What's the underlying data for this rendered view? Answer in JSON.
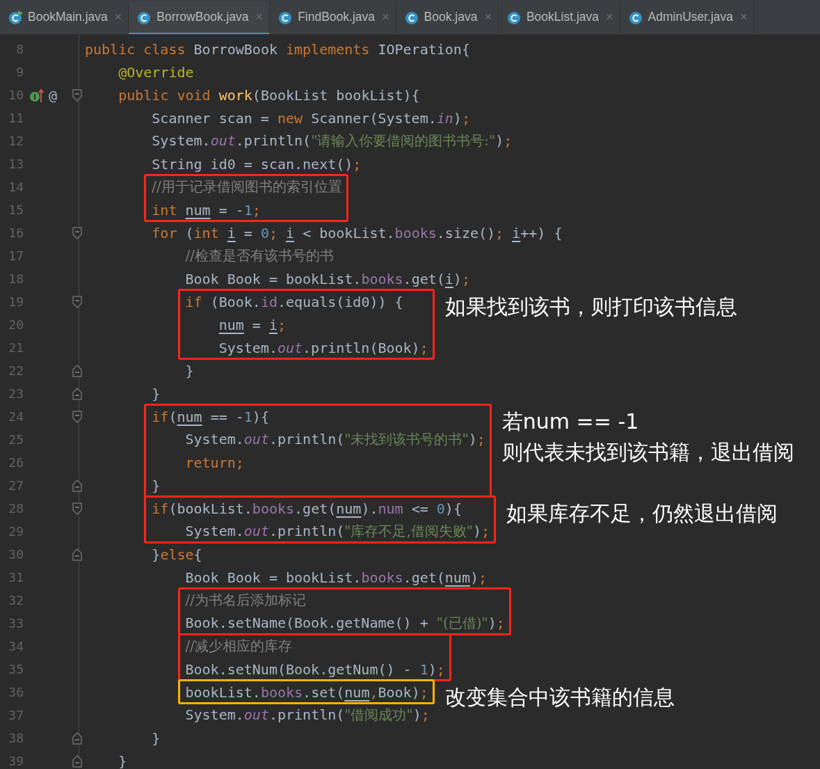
{
  "tabs": [
    {
      "label": "BookMain.java",
      "selected": false,
      "runnable": true,
      "close": "×"
    },
    {
      "label": "BorrowBook.java",
      "selected": true,
      "runnable": false,
      "close": "×"
    },
    {
      "label": "FindBook.java",
      "selected": false,
      "runnable": false,
      "close": "×"
    },
    {
      "label": "Book.java",
      "selected": false,
      "runnable": false,
      "close": "×"
    },
    {
      "label": "BookList.java",
      "selected": false,
      "runnable": false,
      "close": "×"
    },
    {
      "label": "AdminUser.java",
      "selected": false,
      "runnable": false,
      "close": "×"
    }
  ],
  "code": [
    {
      "kind": "line",
      "number": "8",
      "tokens": [
        {
          "kind": "kw",
          "text": "public class "
        },
        {
          "kind": "text",
          "text": "BorrowBook "
        },
        {
          "kind": "kw",
          "text": "implements "
        },
        {
          "kind": "text",
          "text": "IOPeration{"
        }
      ]
    },
    {
      "kind": "line",
      "number": "9",
      "tokens": [
        {
          "kind": "ann",
          "text": "    @Override"
        }
      ]
    },
    {
      "kind": "line",
      "number": "10",
      "fold_start": true,
      "implements_marker": true,
      "gutter_mark": "@",
      "tokens": [
        {
          "kind": "kw",
          "text": "    public void "
        },
        {
          "kind": "fn",
          "text": "work"
        },
        {
          "kind": "text",
          "text": "(BookList bookList){"
        }
      ]
    },
    {
      "kind": "line",
      "number": "11",
      "tokens": [
        {
          "kind": "text",
          "text": "        Scanner scan = "
        },
        {
          "kind": "kw",
          "text": "new "
        },
        {
          "kind": "text",
          "text": "Scanner(System."
        },
        {
          "kind": "static",
          "text": "in"
        },
        {
          "kind": "text",
          "text": ")"
        },
        {
          "kind": "kw",
          "text": ";"
        }
      ]
    },
    {
      "kind": "line",
      "number": "12",
      "tokens": [
        {
          "kind": "text",
          "text": "        System."
        },
        {
          "kind": "static",
          "text": "out"
        },
        {
          "kind": "text",
          "text": ".println("
        },
        {
          "kind": "str",
          "text": "\"请输入你要借阅的图书书号:\""
        },
        {
          "kind": "text",
          "text": ")"
        },
        {
          "kind": "kw",
          "text": ";"
        }
      ]
    },
    {
      "kind": "line",
      "number": "13",
      "tokens": [
        {
          "kind": "text",
          "text": "        String id0 = scan.next()"
        },
        {
          "kind": "kw",
          "text": ";"
        }
      ]
    },
    {
      "kind": "box",
      "color": "#ff2419",
      "lines": [
        {
          "kind": "line",
          "number": "14",
          "tokens": [
            {
              "kind": "comment",
              "text": "        //用于记录借阅图书的索引位置"
            }
          ]
        },
        {
          "kind": "line",
          "number": "15",
          "tokens": [
            {
              "kind": "kw",
              "text": "        int "
            },
            {
              "kind": "var",
              "text": "num"
            },
            {
              "kind": "text",
              "text": " = -"
            },
            {
              "kind": "num",
              "text": "1"
            },
            {
              "kind": "kw",
              "text": ";"
            }
          ]
        }
      ]
    },
    {
      "kind": "line",
      "number": "16",
      "fold_start": true,
      "tokens": [
        {
          "kind": "kw",
          "text": "        for "
        },
        {
          "kind": "text",
          "text": "("
        },
        {
          "kind": "kw",
          "text": "int "
        },
        {
          "kind": "var",
          "text": "i"
        },
        {
          "kind": "text",
          "text": " = "
        },
        {
          "kind": "num",
          "text": "0"
        },
        {
          "kind": "kw",
          "text": "; "
        },
        {
          "kind": "var",
          "text": "i"
        },
        {
          "kind": "text",
          "text": " < bookList."
        },
        {
          "kind": "field",
          "text": "books"
        },
        {
          "kind": "text",
          "text": ".size()"
        },
        {
          "kind": "kw",
          "text": "; "
        },
        {
          "kind": "var",
          "text": "i"
        },
        {
          "kind": "text",
          "text": "++) {"
        }
      ]
    },
    {
      "kind": "line",
      "number": "17",
      "tokens": [
        {
          "kind": "comment",
          "text": "            //检查是否有该书号的书"
        }
      ]
    },
    {
      "kind": "line",
      "number": "18",
      "tokens": [
        {
          "kind": "text",
          "text": "            Book Book = bookList."
        },
        {
          "kind": "field",
          "text": "books"
        },
        {
          "kind": "text",
          "text": ".get("
        },
        {
          "kind": "var",
          "text": "i"
        },
        {
          "kind": "text",
          "text": ")"
        },
        {
          "kind": "kw",
          "text": ";"
        }
      ]
    },
    {
      "kind": "box",
      "color": "#ff2419",
      "note": [
        "如果找到该书，则打印该书信息"
      ],
      "lines": [
        {
          "kind": "line",
          "number": "19",
          "fold_start": true,
          "tokens": [
            {
              "kind": "kw",
              "text": "            if "
            },
            {
              "kind": "text",
              "text": "(Book."
            },
            {
              "kind": "field",
              "text": "id"
            },
            {
              "kind": "text",
              "text": ".equals(id0)) {"
            }
          ]
        },
        {
          "kind": "line",
          "number": "20",
          "tokens": [
            {
              "kind": "var",
              "text": "                num"
            },
            {
              "kind": "text",
              "text": " = "
            },
            {
              "kind": "var",
              "text": "i"
            },
            {
              "kind": "kw",
              "text": ";"
            }
          ]
        },
        {
          "kind": "line",
          "number": "21",
          "tokens": [
            {
              "kind": "text",
              "text": "                System."
            },
            {
              "kind": "static",
              "text": "out"
            },
            {
              "kind": "text",
              "text": ".println(Book)"
            },
            {
              "kind": "kw",
              "text": ";"
            }
          ]
        }
      ]
    },
    {
      "kind": "line",
      "number": "22",
      "fold_end": true,
      "tokens": [
        {
          "kind": "text",
          "text": "            }"
        }
      ]
    },
    {
      "kind": "line",
      "number": "23",
      "fold_end": true,
      "tokens": [
        {
          "kind": "text",
          "text": "        }"
        }
      ]
    },
    {
      "kind": "box",
      "color": "#ff2419",
      "note": [
        "若num == -1",
        "则代表未找到该书籍，退出借阅"
      ],
      "lines": [
        {
          "kind": "line",
          "number": "24",
          "fold_start": true,
          "tokens": [
            {
              "kind": "kw",
              "text": "        if"
            },
            {
              "kind": "text",
              "text": "("
            },
            {
              "kind": "var",
              "text": "num"
            },
            {
              "kind": "text",
              "text": " == -"
            },
            {
              "kind": "num",
              "text": "1"
            },
            {
              "kind": "text",
              "text": "){"
            }
          ]
        },
        {
          "kind": "line",
          "number": "25",
          "tokens": [
            {
              "kind": "text",
              "text": "            System."
            },
            {
              "kind": "static",
              "text": "out"
            },
            {
              "kind": "text",
              "text": ".println("
            },
            {
              "kind": "str",
              "text": "\"未找到该书号的书\""
            },
            {
              "kind": "text",
              "text": ")"
            },
            {
              "kind": "kw",
              "text": ";"
            }
          ]
        },
        {
          "kind": "line",
          "number": "26",
          "tokens": [
            {
              "kind": "kw",
              "text": "            return;"
            }
          ]
        },
        {
          "kind": "line",
          "number": "27",
          "fold_end": true,
          "tokens": [
            {
              "kind": "text",
              "text": "        }"
            }
          ]
        }
      ]
    },
    {
      "kind": "box",
      "color": "#ff2419",
      "note": [
        "如果库存不足，仍然退出借阅"
      ],
      "lines": [
        {
          "kind": "line",
          "number": "28",
          "fold_start": true,
          "tokens": [
            {
              "kind": "kw",
              "text": "        if"
            },
            {
              "kind": "text",
              "text": "(bookList."
            },
            {
              "kind": "field",
              "text": "books"
            },
            {
              "kind": "text",
              "text": ".get("
            },
            {
              "kind": "var",
              "text": "num"
            },
            {
              "kind": "text",
              "text": ")."
            },
            {
              "kind": "field",
              "text": "num"
            },
            {
              "kind": "text",
              "text": " <= "
            },
            {
              "kind": "num",
              "text": "0"
            },
            {
              "kind": "text",
              "text": "){"
            }
          ]
        },
        {
          "kind": "line",
          "number": "29",
          "tokens": [
            {
              "kind": "text",
              "text": "            System."
            },
            {
              "kind": "static",
              "text": "out"
            },
            {
              "kind": "text",
              "text": ".println("
            },
            {
              "kind": "str",
              "text": "\"库存不足,借阅失败\""
            },
            {
              "kind": "text",
              "text": ")"
            },
            {
              "kind": "kw",
              "text": ";"
            }
          ]
        }
      ]
    },
    {
      "kind": "line",
      "number": "30",
      "fold_end": true,
      "tokens": [
        {
          "kind": "text",
          "text": "        }"
        },
        {
          "kind": "kw",
          "text": "else"
        },
        {
          "kind": "text",
          "text": "{"
        }
      ]
    },
    {
      "kind": "line",
      "number": "31",
      "tokens": [
        {
          "kind": "text",
          "text": "            Book Book = bookList."
        },
        {
          "kind": "field",
          "text": "books"
        },
        {
          "kind": "text",
          "text": ".get("
        },
        {
          "kind": "var",
          "text": "num"
        },
        {
          "kind": "text",
          "text": ")"
        },
        {
          "kind": "kw",
          "text": ";"
        }
      ]
    },
    {
      "kind": "box",
      "color": "#ff2419",
      "lines": [
        {
          "kind": "line",
          "number": "32",
          "tokens": [
            {
              "kind": "comment",
              "text": "            //为书名后添加标记"
            }
          ]
        },
        {
          "kind": "line",
          "number": "33",
          "tokens": [
            {
              "kind": "text",
              "text": "            Book.setName(Book.getName() + "
            },
            {
              "kind": "str",
              "text": "\"(已借)\""
            },
            {
              "kind": "text",
              "text": ")"
            },
            {
              "kind": "kw",
              "text": ";"
            }
          ]
        }
      ]
    },
    {
      "kind": "box",
      "color": "#ff2419",
      "lines": [
        {
          "kind": "line",
          "number": "34",
          "tokens": [
            {
              "kind": "comment",
              "text": "            //减少相应的库存"
            }
          ]
        },
        {
          "kind": "line",
          "number": "35",
          "tokens": [
            {
              "kind": "text",
              "text": "            Book.setNum(Book.getNum() - "
            },
            {
              "kind": "num",
              "text": "1"
            },
            {
              "kind": "text",
              "text": ")"
            },
            {
              "kind": "kw",
              "text": ";"
            }
          ]
        }
      ]
    },
    {
      "kind": "box",
      "color": "#ffb300",
      "note": [
        "改变集合中该书籍的信息"
      ],
      "lines": [
        {
          "kind": "line",
          "number": "36",
          "tokens": [
            {
              "kind": "text",
              "text": "            bookList."
            },
            {
              "kind": "field",
              "text": "books"
            },
            {
              "kind": "text",
              "text": ".set("
            },
            {
              "kind": "var",
              "text": "num"
            },
            {
              "kind": "kw",
              "text": ","
            },
            {
              "kind": "text",
              "text": "Book)"
            },
            {
              "kind": "kw",
              "text": ";"
            }
          ]
        }
      ]
    },
    {
      "kind": "line",
      "number": "37",
      "tokens": [
        {
          "kind": "text",
          "text": "            System."
        },
        {
          "kind": "static",
          "text": "out"
        },
        {
          "kind": "text",
          "text": ".println("
        },
        {
          "kind": "str",
          "text": "\"借阅成功\""
        },
        {
          "kind": "text",
          "text": ")"
        },
        {
          "kind": "kw",
          "text": ";"
        }
      ]
    },
    {
      "kind": "line",
      "number": "38",
      "fold_end": true,
      "tokens": [
        {
          "kind": "text",
          "text": "        }"
        }
      ]
    },
    {
      "kind": "line",
      "number": "39",
      "fold_end": true,
      "tokens": [
        {
          "kind": "text",
          "text": "    }"
        }
      ]
    }
  ]
}
